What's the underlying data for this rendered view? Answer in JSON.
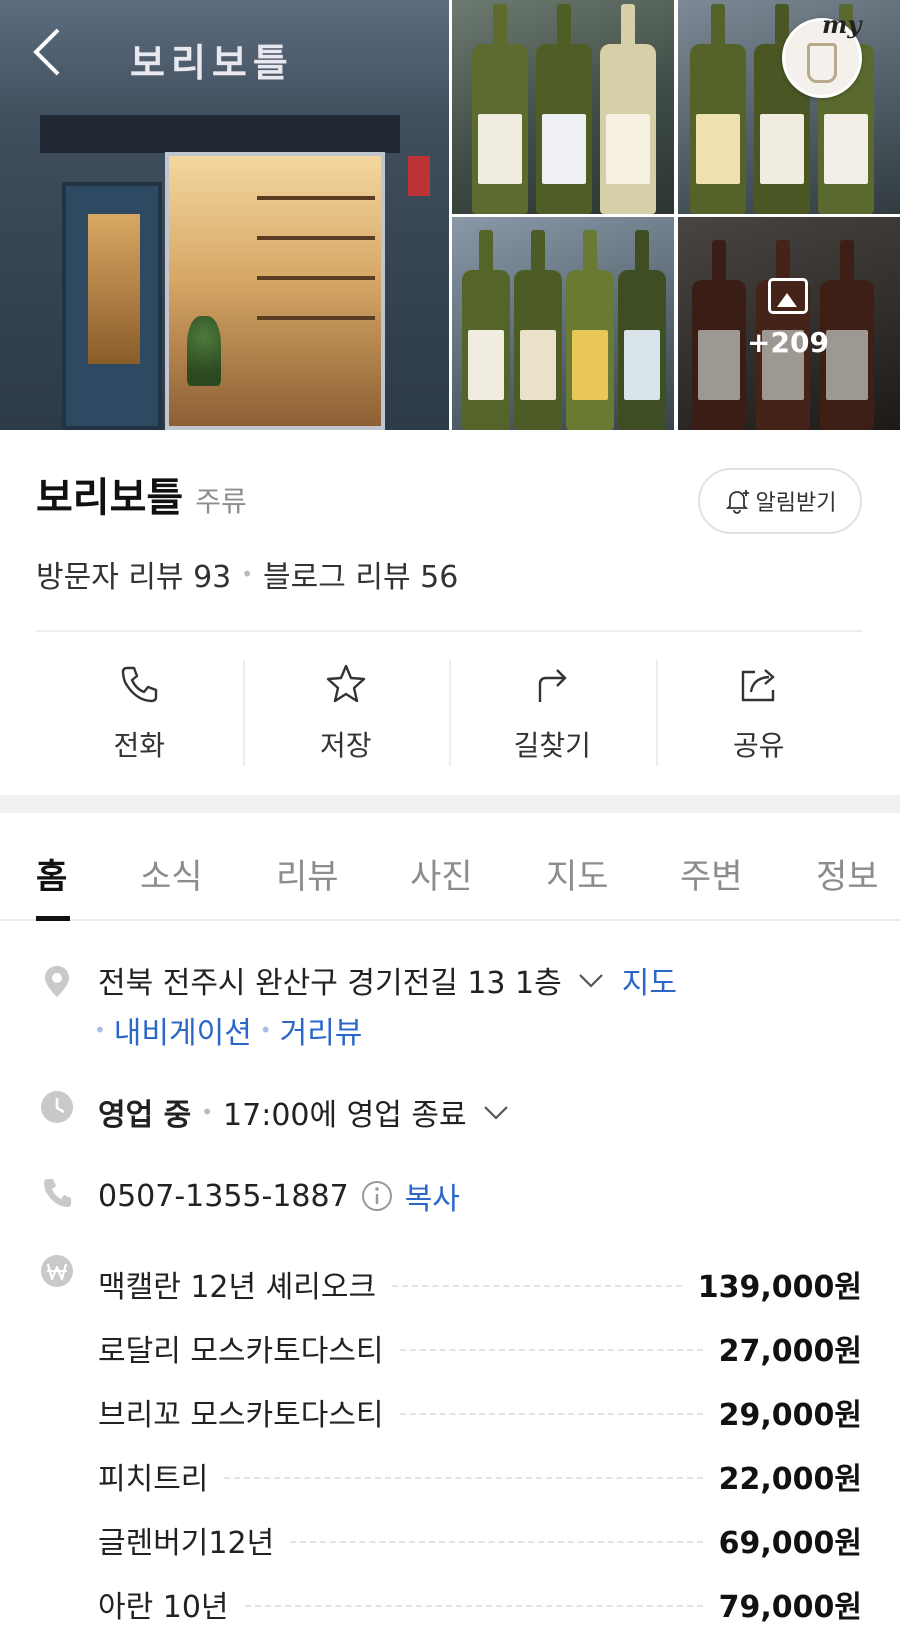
{
  "header": {
    "shop_sign": "보리보틀",
    "photo_more_count": "+209",
    "my_badge": "my"
  },
  "place": {
    "name": "보리보틀",
    "category": "주류",
    "alert_label": "알림받기",
    "visitor_reviews": "방문자 리뷰 93",
    "blog_reviews": "블로그 리뷰 56"
  },
  "actions": [
    {
      "label": "전화",
      "icon": "phone-icon"
    },
    {
      "label": "저장",
      "icon": "star-icon"
    },
    {
      "label": "길찾기",
      "icon": "directions-icon"
    },
    {
      "label": "공유",
      "icon": "share-icon"
    }
  ],
  "tabs": [
    "홈",
    "소식",
    "리뷰",
    "사진",
    "지도",
    "주변",
    "정보"
  ],
  "active_tab": "홈",
  "info": {
    "address": "전북 전주시 완산구 경기전길 13 1층",
    "map_link": "지도",
    "navigation_link": "내비게이션",
    "street_view_link": "거리뷰",
    "hours_status": "영업 중",
    "hours_detail": "17:00에 영업 종료",
    "phone": "0507-1355-1887",
    "copy_label": "복사"
  },
  "menu": [
    {
      "name": "맥캘란 12년 셰리오크",
      "price": "139,000원"
    },
    {
      "name": "로달리 모스카토다스티",
      "price": "27,000원"
    },
    {
      "name": "브리꼬 모스카토다스티",
      "price": "29,000원"
    },
    {
      "name": "피치트리",
      "price": "22,000원"
    },
    {
      "name": "글렌버기12년",
      "price": "69,000원"
    },
    {
      "name": "아란 10년",
      "price": "79,000원"
    }
  ],
  "colors": {
    "link": "#2b67c9",
    "separator": "#eeeeee",
    "muted_text": "#8c8c8c"
  }
}
